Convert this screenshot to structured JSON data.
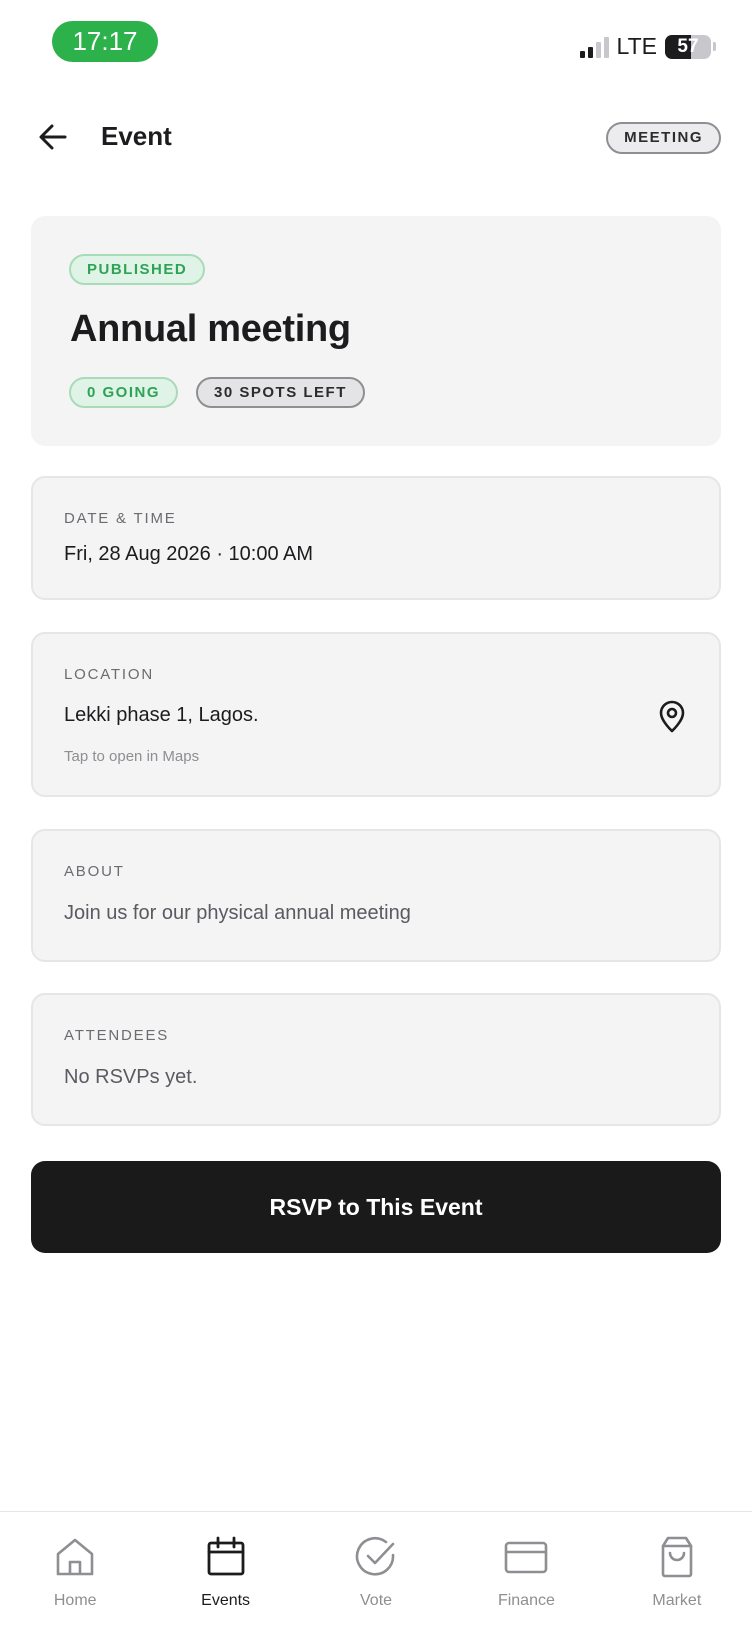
{
  "status_bar": {
    "time": "17:17",
    "network": "LTE",
    "battery_level": "57",
    "battery_fraction": 0.57
  },
  "header": {
    "title": "Event",
    "type_badge": "MEETING"
  },
  "event": {
    "status": "PUBLISHED",
    "title": "Annual meeting",
    "going": "0 GOING",
    "spots_left": "30 SPOTS LEFT"
  },
  "date_time": {
    "label": "DATE & TIME",
    "value": "Fri, 28 Aug 2026 · 10:00 AM"
  },
  "location": {
    "label": "LOCATION",
    "value": "Lekki phase 1, Lagos.",
    "hint": "Tap to open in Maps"
  },
  "about": {
    "label": "ABOUT",
    "value": "Join us for our physical annual meeting"
  },
  "attendees": {
    "label": "ATTENDEES",
    "value": "No RSVPs yet."
  },
  "rsvp_button": "RSVP to This Event",
  "tabbar": [
    {
      "label": "Home",
      "icon": "home-icon",
      "active": false
    },
    {
      "label": "Events",
      "icon": "calendar-icon",
      "active": true
    },
    {
      "label": "Vote",
      "icon": "check-circle-icon",
      "active": false
    },
    {
      "label": "Finance",
      "icon": "card-icon",
      "active": false
    },
    {
      "label": "Market",
      "icon": "bag-icon",
      "active": false
    }
  ],
  "colors": {
    "accent_green": "#2db14a",
    "primary_button": "#1a1a1a",
    "card_bg": "#f4f4f5"
  }
}
